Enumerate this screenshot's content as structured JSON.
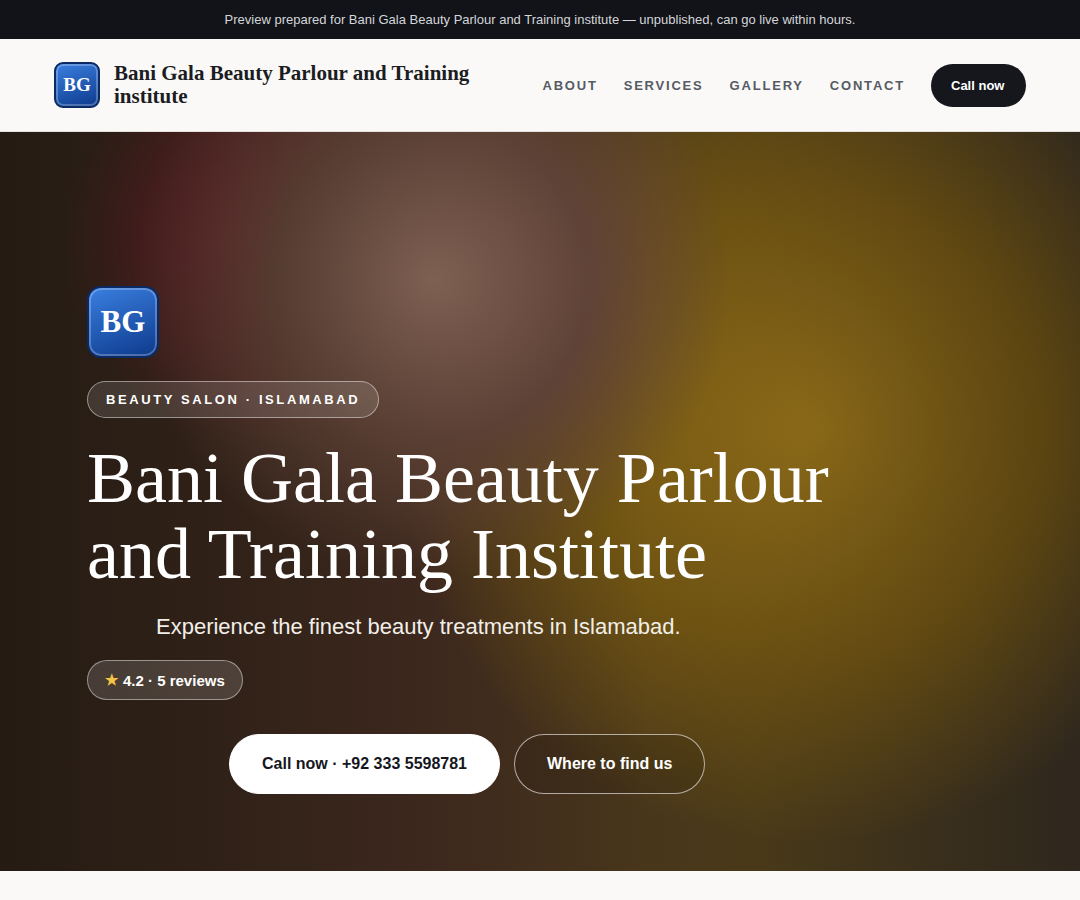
{
  "banner": {
    "text": "Preview prepared for Bani Gala Beauty Parlour and Training institute — unpublished, can go live within hours."
  },
  "header": {
    "logo": "BG",
    "brand": "Bani Gala Beauty Parlour and Training institute",
    "nav": [
      {
        "label": "ABOUT"
      },
      {
        "label": "SERVICES"
      },
      {
        "label": "GALLERY"
      },
      {
        "label": "CONTACT"
      }
    ],
    "cta": "Call now"
  },
  "hero": {
    "logo": "BG",
    "tag": "BEAUTY SALON · ISLAMABAD",
    "title": "Bani Gala Beauty Parlour and Training Institute",
    "subtitle": "Experience the finest beauty treatments in Islamabad.",
    "rating": {
      "star": "★",
      "text": "4.2 · 5 reviews"
    },
    "buttons": [
      {
        "label": "Call now · +92 333 5598781",
        "kind": "primary"
      },
      {
        "label": "Where to find us",
        "kind": "outline"
      }
    ]
  }
}
